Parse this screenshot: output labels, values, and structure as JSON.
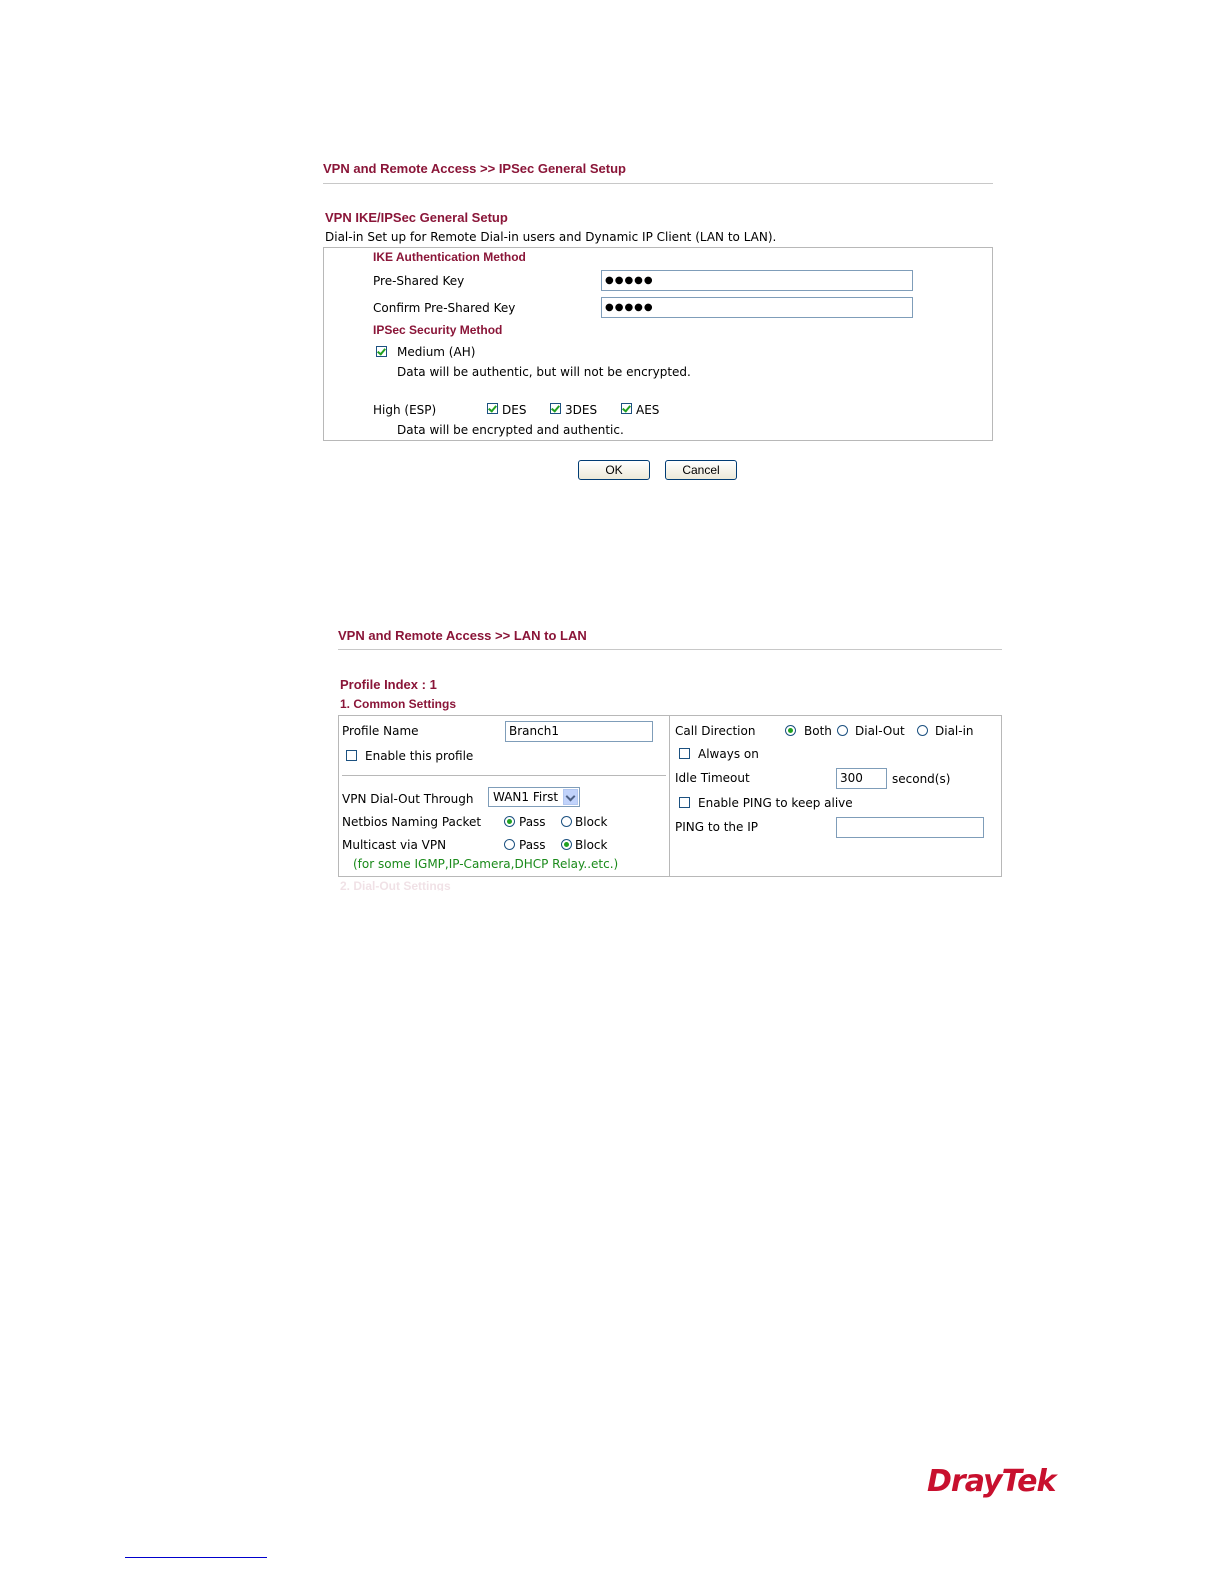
{
  "ipsec": {
    "breadcrumb": "VPN and Remote Access >> IPSec General Setup",
    "title": "VPN IKE/IPSec General Setup",
    "description": "Dial-in Set up for Remote Dial-in users and Dynamic IP Client (LAN to LAN).",
    "ike_heading": "IKE Authentication Method",
    "psk_label": "Pre-Shared Key",
    "psk_value": "●●●●●",
    "confirm_label": "Confirm Pre-Shared Key",
    "confirm_value": "●●●●●",
    "sec_heading": "IPSec Security Method",
    "medium_label": "Medium (AH)",
    "medium_checked": true,
    "medium_note": "Data will be authentic, but will not be encrypted.",
    "high_label": "High (ESP)",
    "des_label": "DES",
    "tdes_label": "3DES",
    "aes_label": "AES",
    "high_note": "Data will be encrypted and authentic.",
    "ok_label": "OK",
    "cancel_label": "Cancel"
  },
  "lan": {
    "breadcrumb": "VPN and Remote Access >> LAN to LAN",
    "profile_index": "Profile Index : 1",
    "common_heading": "1. Common Settings",
    "profile_name_label": "Profile Name",
    "profile_name_value": "Branch1",
    "enable_label": "Enable this profile",
    "dialout_label": "VPN Dial-Out Through",
    "dialout_value": "WAN1 First",
    "netbios_label": "Netbios Naming Packet",
    "pass_label": "Pass",
    "block_label": "Block",
    "multicast_label": "Multicast via VPN",
    "multicast_note": "(for some IGMP,IP-Camera,DHCP Relay..etc.)",
    "call_direction_label": "Call Direction",
    "both_label": "Both",
    "dial_out_label": "Dial-Out",
    "dial_in_label": "Dial-in",
    "always_on_label": "Always on",
    "idle_timeout_label": "Idle Timeout",
    "idle_timeout_value": "300",
    "seconds_label": "second(s)",
    "ping_enable_label": "Enable PING to keep alive",
    "ping_ip_label": "PING to the IP",
    "ping_ip_value": "",
    "dialout_heading_cut": "2. Dial-Out Settings"
  },
  "footer": {
    "logo_text": "DrayTek"
  }
}
